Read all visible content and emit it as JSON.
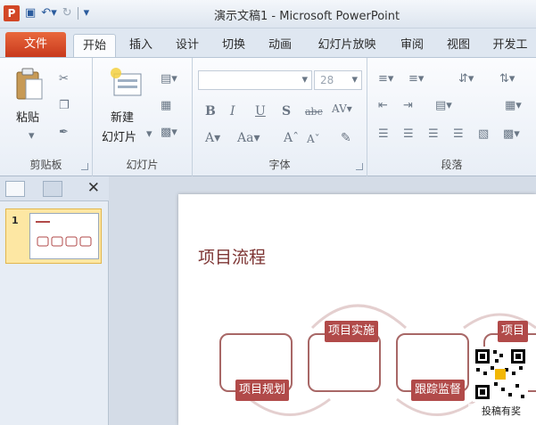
{
  "window": {
    "title": "演示文稿1 - Microsoft PowerPoint",
    "app_logo": "P"
  },
  "tabs": [
    {
      "label": "文件"
    },
    {
      "label": "开始"
    },
    {
      "label": "插入"
    },
    {
      "label": "设计"
    },
    {
      "label": "切换"
    },
    {
      "label": "动画"
    },
    {
      "label": "幻灯片放映"
    },
    {
      "label": "审阅"
    },
    {
      "label": "视图"
    },
    {
      "label": "开发工"
    }
  ],
  "ribbon": {
    "clipboard": {
      "label": "剪贴板",
      "paste": "粘贴"
    },
    "slides": {
      "label": "幻灯片",
      "new_slide_line1": "新建",
      "new_slide_line2": "幻灯片"
    },
    "font": {
      "label": "字体",
      "size": "28"
    },
    "paragraph": {
      "label": "段落"
    }
  },
  "pane": {
    "slide_number": "1"
  },
  "slide": {
    "title": "项目流程",
    "steps": [
      {
        "label": "项目规划"
      },
      {
        "label": "项目实施"
      },
      {
        "label": "跟踪监督"
      },
      {
        "label": "项目"
      }
    ]
  },
  "watermark": "投稿有奖",
  "colors": {
    "file_tab": "#c8391c",
    "accent": "#b14a49",
    "title": "#7d3433"
  }
}
